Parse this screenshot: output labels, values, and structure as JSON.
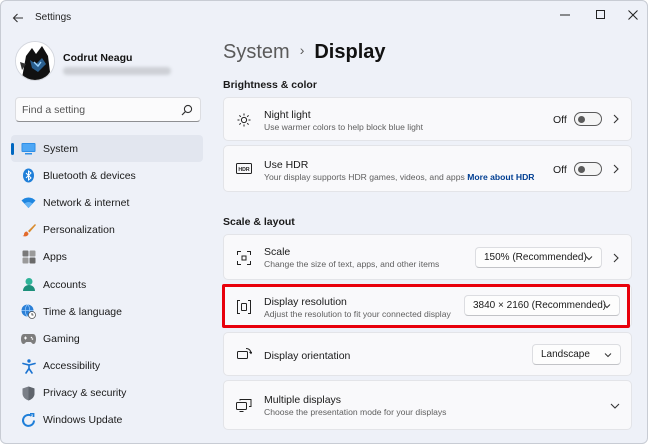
{
  "window": {
    "title": "Settings"
  },
  "profile": {
    "name": "Codrut Neagu"
  },
  "search": {
    "placeholder": "Find a setting"
  },
  "sidebar": {
    "items": [
      {
        "label": "System",
        "icon": "monitor-icon",
        "active": true
      },
      {
        "label": "Bluetooth & devices",
        "icon": "bluetooth-icon"
      },
      {
        "label": "Network & internet",
        "icon": "wifi-icon"
      },
      {
        "label": "Personalization",
        "icon": "brush-icon"
      },
      {
        "label": "Apps",
        "icon": "apps-icon"
      },
      {
        "label": "Accounts",
        "icon": "accounts-icon"
      },
      {
        "label": "Time & language",
        "icon": "globe-clock-icon"
      },
      {
        "label": "Gaming",
        "icon": "gamepad-icon"
      },
      {
        "label": "Accessibility",
        "icon": "accessibility-icon"
      },
      {
        "label": "Privacy & security",
        "icon": "shield-icon"
      },
      {
        "label": "Windows Update",
        "icon": "update-icon"
      }
    ]
  },
  "breadcrumb": {
    "parent": "System",
    "separator": "›",
    "current": "Display"
  },
  "sections": {
    "brightness": "Brightness & color",
    "scale_layout": "Scale & layout"
  },
  "night_light": {
    "title": "Night light",
    "subtitle": "Use warmer colors to help block blue light",
    "state": "Off"
  },
  "hdr": {
    "title": "Use HDR",
    "subtitle": "Your display supports HDR games, videos, and apps",
    "link": "More about HDR",
    "state": "Off",
    "icon_text": "HDR"
  },
  "scale": {
    "title": "Scale",
    "subtitle": "Change the size of text, apps, and other items",
    "value": "150% (Recommended)"
  },
  "resolution": {
    "title": "Display resolution",
    "subtitle": "Adjust the resolution to fit your connected display",
    "value": "3840 × 2160 (Recommended)"
  },
  "orientation": {
    "title": "Display orientation",
    "value": "Landscape"
  },
  "multiple": {
    "title": "Multiple displays",
    "subtitle": "Choose the presentation mode for your displays"
  },
  "colors": {
    "accent": "#0067c0",
    "highlight": "#e8000b",
    "background": "#eef1f8"
  }
}
